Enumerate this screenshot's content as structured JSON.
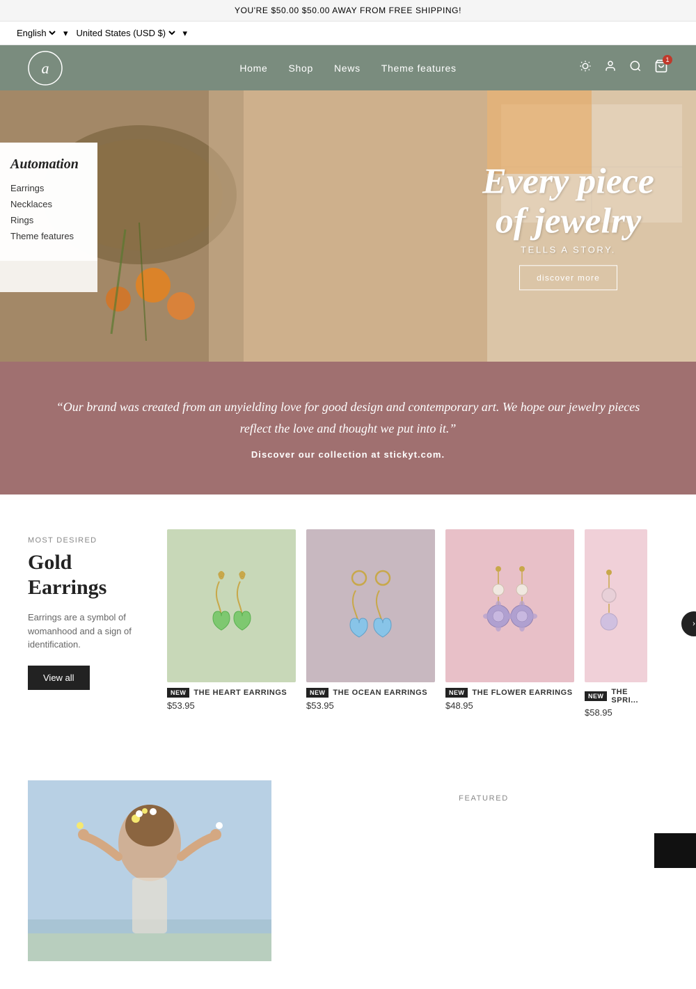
{
  "announcement": {
    "text": "YOU'RE $50.00 $50.00 AWAY FROM FREE SHIPPING!"
  },
  "lang_bar": {
    "language": "English",
    "currency": "United States (USD $)"
  },
  "nav": {
    "items": [
      {
        "label": "Home",
        "href": "#"
      },
      {
        "label": "Shop",
        "href": "#"
      },
      {
        "label": "News",
        "href": "#"
      },
      {
        "label": "Theme features",
        "href": "#"
      }
    ]
  },
  "hero": {
    "brand_name": "Automation",
    "menu_items": [
      {
        "label": "Earrings"
      },
      {
        "label": "Necklaces"
      },
      {
        "label": "Rings"
      },
      {
        "label": "Theme features"
      }
    ],
    "headline_line1": "Every piece",
    "headline_line2": "of jewelry",
    "subtitle": "TELLS A STORY.",
    "cta_label": "discover more"
  },
  "quote": {
    "text": "“Our brand was created from an unyielding love for good design and contemporary art. We hope our jewelry pieces reflect the love and thought we put into it.”",
    "tagline": "Discover our collection at stickyt.com."
  },
  "products_section": {
    "tag": "MOST DESIRED",
    "heading": "Gold Earrings",
    "description": "Earrings are a symbol of womanhood and a sign of identification.",
    "cta_label": "View all",
    "products": [
      {
        "name": "THE HEART EARRINGS",
        "badge": "NEW",
        "price": "$53.95",
        "bg": "green-bg"
      },
      {
        "name": "THE OCEAN EARRINGS",
        "badge": "NEW",
        "price": "$53.95",
        "bg": "mauve-bg"
      },
      {
        "name": "THE FLOWER EARRINGS",
        "badge": "NEW",
        "price": "$48.95",
        "bg": "pink-bg"
      },
      {
        "name": "THE SPRI...",
        "badge": "NEW",
        "price": "$58.95",
        "bg": "light-pink-bg"
      }
    ]
  },
  "bottom_section": {
    "featured_tag": "FEATURED"
  },
  "cart_count": "1"
}
